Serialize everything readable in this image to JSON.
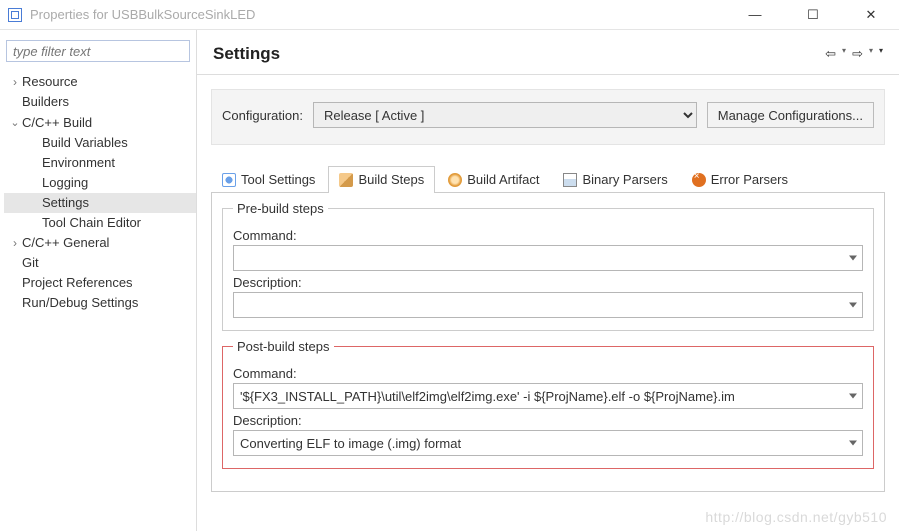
{
  "titlebar": {
    "title": "Properties for USBBulkSourceSinkLED"
  },
  "filter": {
    "placeholder": "type filter text"
  },
  "tree": {
    "resource": "Resource",
    "builders": "Builders",
    "ccbuild": "C/C++ Build",
    "buildvars": "Build Variables",
    "env": "Environment",
    "logging": "Logging",
    "settings": "Settings",
    "toolchain": "Tool Chain Editor",
    "ccgeneral": "C/C++ General",
    "git": "Git",
    "projrefs": "Project References",
    "rundebug": "Run/Debug Settings"
  },
  "header": {
    "title": "Settings"
  },
  "config": {
    "label": "Configuration:",
    "value": "Release  [ Active ]",
    "manage": "Manage Configurations..."
  },
  "tabs": {
    "tool": "Tool Settings",
    "steps": "Build Steps",
    "artifact": "Build Artifact",
    "binary": "Binary Parsers",
    "error": "Error Parsers"
  },
  "pre": {
    "legend": "Pre-build steps",
    "cmd_label": "Command:",
    "cmd_value": "",
    "desc_label": "Description:",
    "desc_value": ""
  },
  "post": {
    "legend": "Post-build steps",
    "cmd_label": "Command:",
    "cmd_value": "'${FX3_INSTALL_PATH}\\util\\elf2img\\elf2img.exe' -i ${ProjName}.elf -o ${ProjName}.im",
    "desc_label": "Description:",
    "desc_value": "Converting ELF to image (.img) format"
  },
  "watermark": "http://blog.csdn.net/gyb510"
}
